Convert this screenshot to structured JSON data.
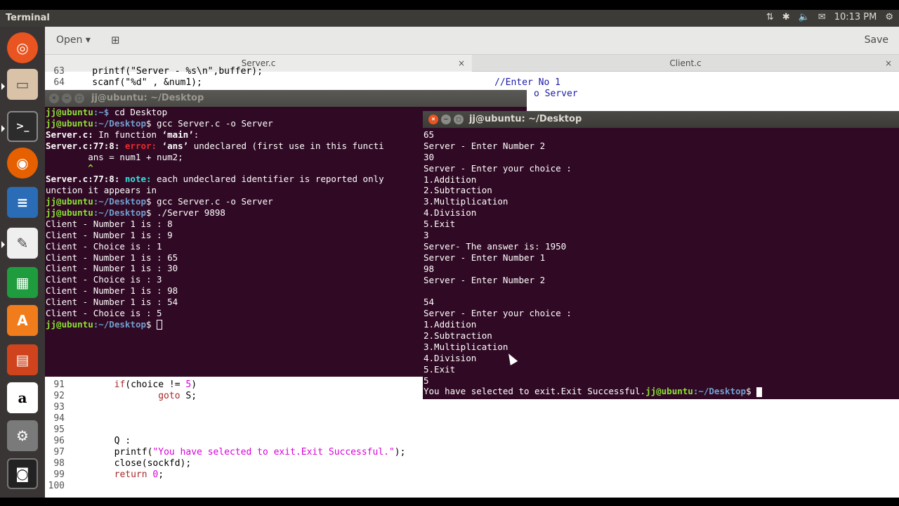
{
  "top_panel": {
    "app_title": "Terminal",
    "time": "10:13 PM",
    "network_icon": "network-updown-icon",
    "bluetooth_icon": "bluetooth-icon",
    "volume_icon": "volume-icon",
    "mail_icon": "mail-icon",
    "settings_icon": "gear-icon"
  },
  "launcher": {
    "items": [
      "ubuntu-dash-icon",
      "files-icon",
      "terminal-icon",
      "firefox-icon",
      "libreoffice-writer-icon",
      "text-editor-icon",
      "libreoffice-calc-icon",
      "software-center-icon",
      "libreoffice-impress-icon",
      "amazon-icon",
      "system-settings-icon",
      "screenshot-icon"
    ]
  },
  "gedit": {
    "open_label": "Open",
    "save_label": "Save",
    "tabs": [
      {
        "label": "Server.c"
      },
      {
        "label": "Client.c"
      }
    ],
    "client_code": [
      "//Enter No 1",
      "o Server"
    ],
    "server_code_top": [
      {
        "ln": "63",
        "text": "    printf(\"Server - %s\\n\",buffer);"
      },
      {
        "ln": "64",
        "text": "    scanf(\"%d\" , &num1);"
      }
    ],
    "server_code_bottom": [
      {
        "ln": "91",
        "kw": "if",
        "text": "(choice != ",
        "num": "5",
        "tail": ")"
      },
      {
        "ln": "92",
        "kw": "goto",
        "text": " S;"
      },
      {
        "ln": "93",
        "text": ""
      },
      {
        "ln": "94",
        "text": ""
      },
      {
        "ln": "95",
        "text": ""
      },
      {
        "ln": "96",
        "text": "Q :"
      },
      {
        "ln": "97",
        "text": "printf(",
        "str": "\"You have selected to exit.Exit Successful.\"",
        "tail": ");"
      },
      {
        "ln": "98",
        "text": "close(sockfd);"
      },
      {
        "ln": "99",
        "kw": "return",
        "text": " ",
        "num": "0",
        "tail": ";"
      },
      {
        "ln": "100",
        "text": ""
      }
    ]
  },
  "terminal_left": {
    "title": "jj@ubuntu: ~/Desktop",
    "prompt_user": "jj@ubuntu",
    "prompt_path": ":~$",
    "prompt_desktop": ":~/Desktop",
    "lines": {
      "l1_cmd": " cd Desktop",
      "l2_cmd": " gcc Server.c -o Server",
      "l3a": "Server.c:",
      "l3b": " In function ",
      "l3c": "‘main’",
      "l3d": ":",
      "l4a": "Server.c:77:8: ",
      "l4b": "error: ",
      "l4c": "‘ans’",
      "l4d": " undeclared (first use in this functi",
      "l5": "        ans = num1 + num2;",
      "l6": "        ^",
      "l7a": "Server.c:77:8: ",
      "l7b": "note: ",
      "l7c": "each undeclared identifier is reported only",
      "l8": "unction it appears in",
      "l9_cmd": " gcc Server.c -o Server",
      "l10_cmd": " ./Server 9898",
      "out": [
        "Client - Number 1 is : 8",
        "Client - Number 1 is : 9",
        "Client - Choice is : 1",
        "Client - Number 1 is : 65",
        "Client - Number 1 is : 30",
        "Client - Choice is : 3",
        "Client - Number 1 is : 98",
        "Client - Number 1 is : 54",
        "Client - Choice is : 5"
      ]
    }
  },
  "terminal_right": {
    "title": "jj@ubuntu: ~/Desktop",
    "lines": [
      "65",
      "Server - Enter Number 2",
      "30",
      "Server - Enter your choice :",
      "1.Addition",
      "2.Subtraction",
      "3.Multiplication",
      "4.Division",
      "5.Exit",
      "3",
      "Server- The answer is: 1950",
      "Server - Enter Number 1",
      "98",
      "Server - Enter Number 2",
      "",
      "54",
      "Server - Enter your choice :",
      "1.Addition",
      "2.Subtraction",
      "3.Multiplication",
      "4.Division",
      "5.Exit",
      "5"
    ],
    "last_plain": "You have selected to exit.Exit Successful.",
    "last_user": "jj@ubuntu",
    "last_path": ":~/Desktop"
  }
}
